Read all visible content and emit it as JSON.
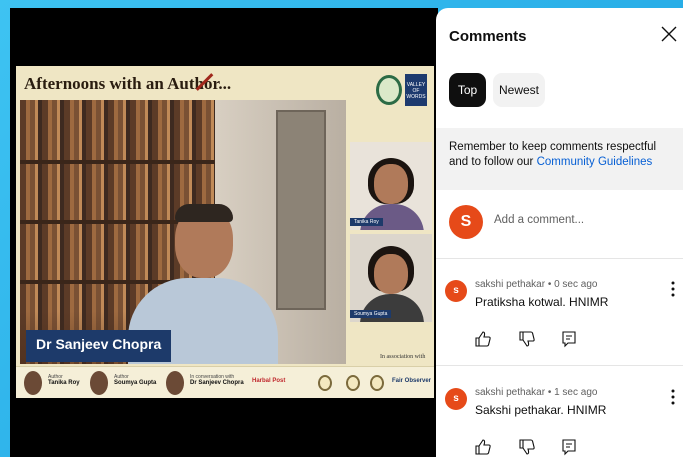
{
  "video": {
    "banner_title": "Afternoons with an Author...",
    "logo_text": "VALLEY OF WORDS",
    "speaker_name_tag": "Dr Sanjeev Chopra",
    "side_participants": [
      {
        "label": "Tanika Roy"
      },
      {
        "label": "Soumya Gupta"
      }
    ],
    "association_text": "In association with",
    "footer": {
      "people": [
        {
          "role": "Author",
          "name": "Tanika Roy"
        },
        {
          "role": "Author",
          "name": "Soumya Gupta"
        },
        {
          "role": "In conversation with",
          "name": "Dr Sanjeev Chopra"
        }
      ],
      "sponsors": [
        "Harbal Post",
        "Fair Observer"
      ]
    }
  },
  "comments_panel": {
    "title": "Comments",
    "tabs": [
      {
        "label": "Top",
        "active": true
      },
      {
        "label": "Newest",
        "active": false
      }
    ],
    "notice_text": "Remember to keep comments respectful and to follow our ",
    "notice_link": "Community Guidelines",
    "add_comment": {
      "avatar_letter": "S",
      "placeholder": "Add a comment..."
    },
    "comments": [
      {
        "avatar_letter": "s",
        "meta": "sakshi pethakar • 0 sec ago",
        "text": "Pratiksha kotwal. HNIMR"
      },
      {
        "avatar_letter": "s",
        "meta": "sakshi pethakar • 1 sec ago",
        "text": "Sakshi pethakar. HNIMR"
      }
    ]
  },
  "colors": {
    "accent_red": "#e64a19",
    "link_blue": "#065fd4",
    "name_tag_navy": "#1d3a6a",
    "frame_blue": "#1a9fe0"
  }
}
